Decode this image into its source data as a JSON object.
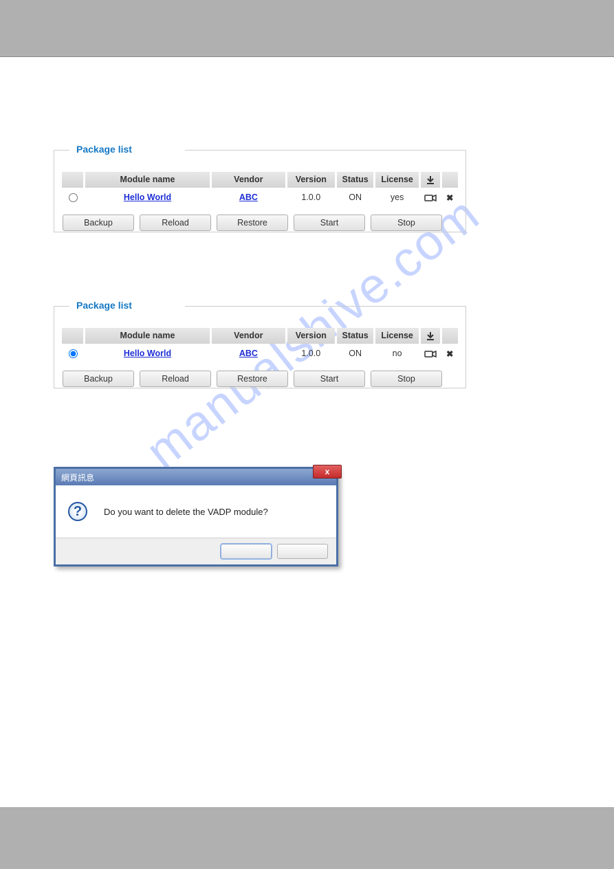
{
  "watermark": "manualshive.com",
  "panel1": {
    "legend": "Package list",
    "headers": {
      "module": "Module name",
      "vendor": "Vendor",
      "version": "Version",
      "status": "Status",
      "license": "License"
    },
    "row": {
      "module": "Hello World",
      "vendor": "ABC",
      "version": "1.0.0",
      "status": "ON",
      "license": "yes"
    },
    "buttons": {
      "backup": "Backup",
      "reload": "Reload",
      "restore": "Restore",
      "start": "Start",
      "stop": "Stop"
    }
  },
  "panel2": {
    "legend": "Package list",
    "headers": {
      "module": "Module name",
      "vendor": "Vendor",
      "version": "Version",
      "status": "Status",
      "license": "License"
    },
    "row": {
      "module": "Hello World",
      "vendor": "ABC",
      "version": "1.0.0",
      "status": "ON",
      "license": "no"
    },
    "buttons": {
      "backup": "Backup",
      "reload": "Reload",
      "restore": "Restore",
      "start": "Start",
      "stop": "Stop"
    }
  },
  "dialog": {
    "title": "網頁訊息",
    "message": "Do you want to delete the VADP module?",
    "close": "x"
  }
}
